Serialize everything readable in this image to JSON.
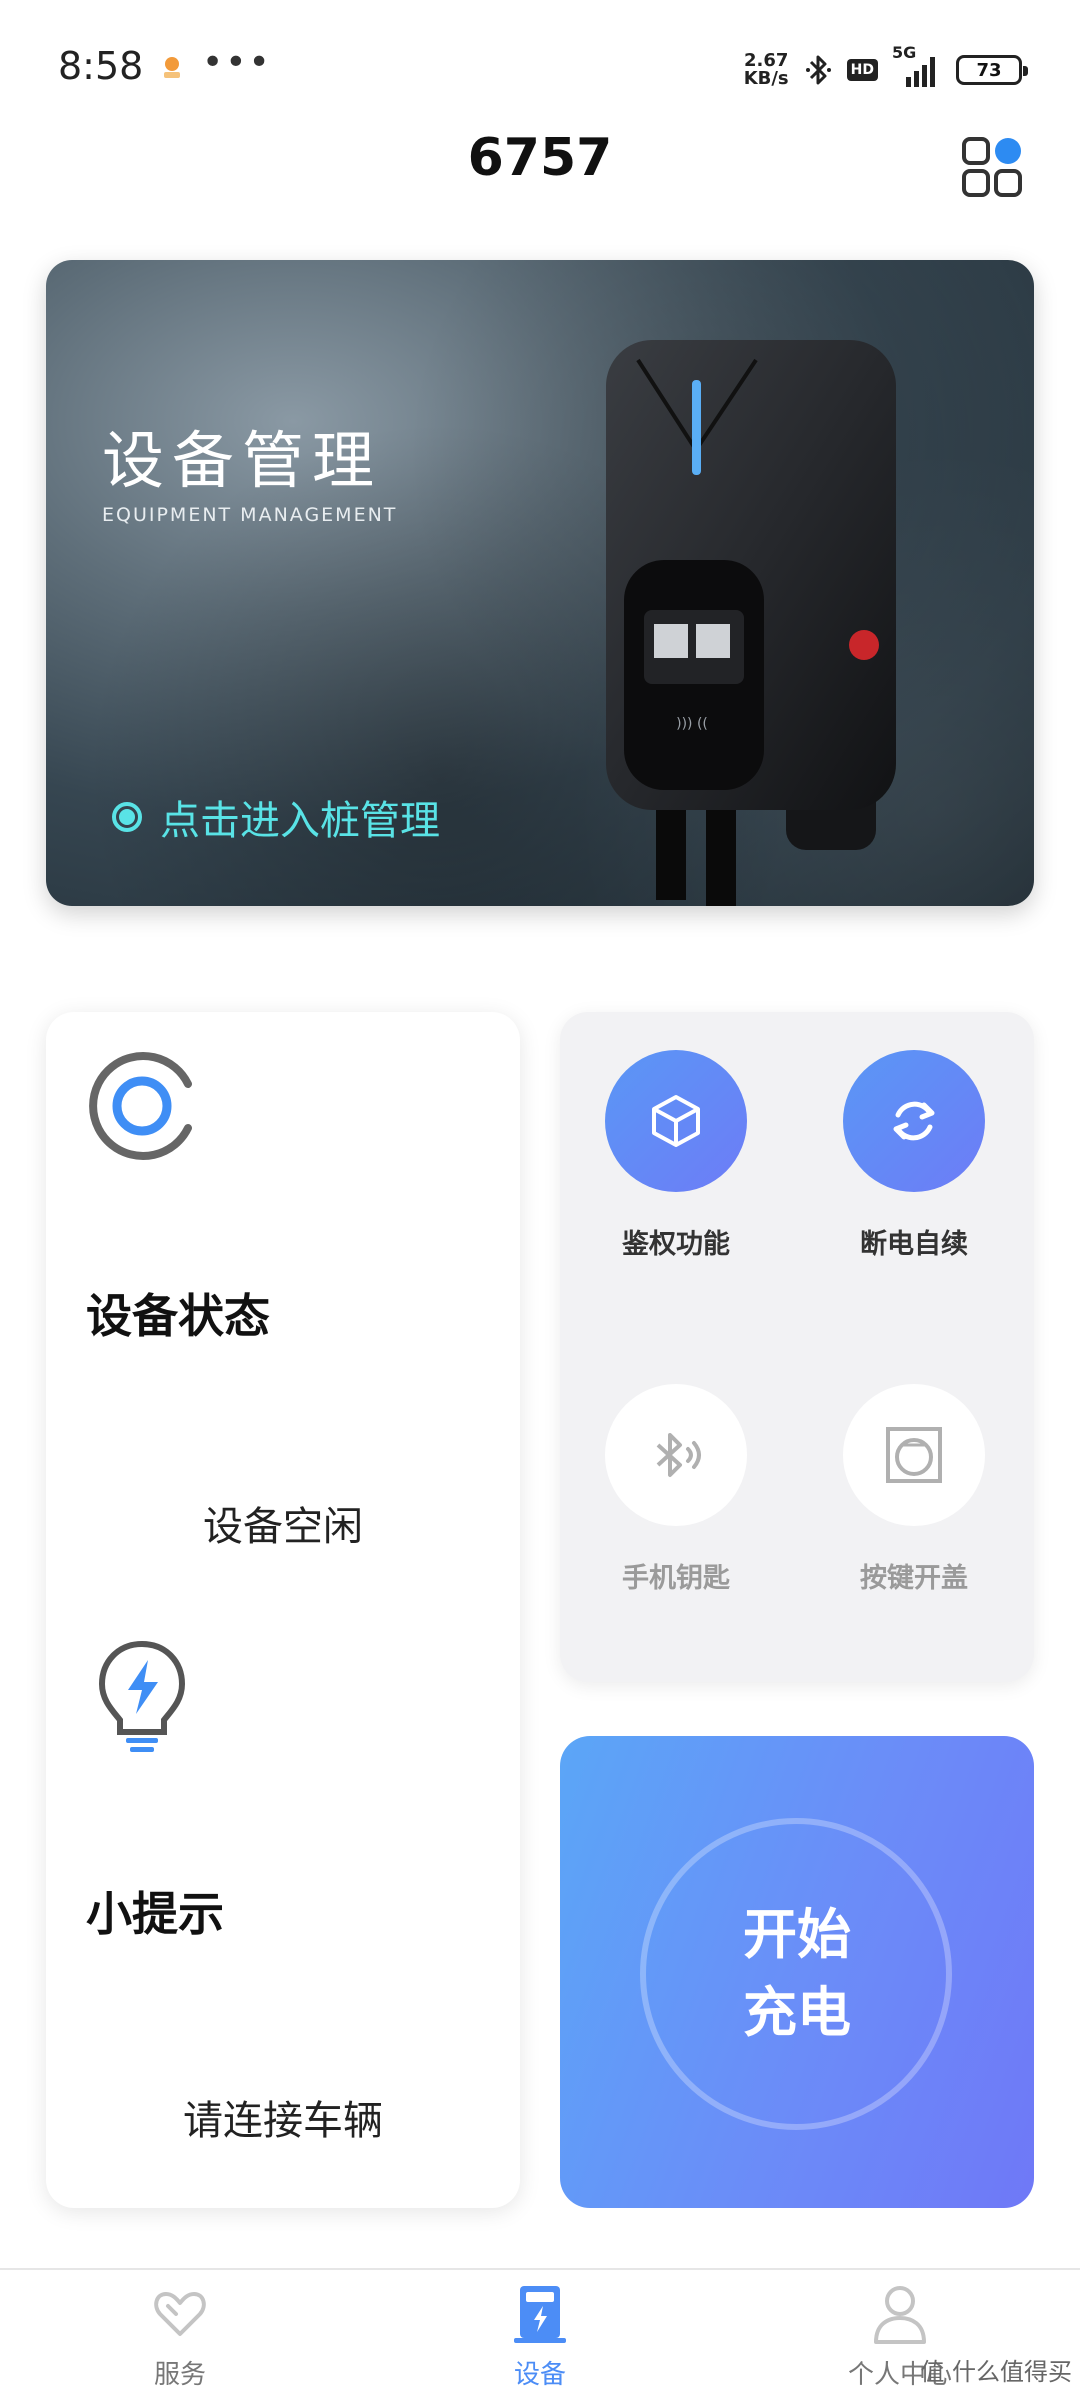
{
  "status_bar": {
    "time": "8:58",
    "more": "•••",
    "net_speed_value": "2.67",
    "net_speed_unit": "KB/s",
    "hd": "HD",
    "network": "5G",
    "battery": "73"
  },
  "header": {
    "title": "6757"
  },
  "banner": {
    "title": "设备管理",
    "subtitle": "EQUIPMENT MANAGEMENT",
    "link": "点击进入桩管理",
    "accent_color": "#59e3e6"
  },
  "status_card": {
    "status_heading": "设备状态",
    "status_value": "设备空闲",
    "tip_heading": "小提示",
    "tip_value": "请连接车辆"
  },
  "functions": [
    {
      "label": "鉴权功能",
      "icon": "cube-icon",
      "enabled": true
    },
    {
      "label": "断电自续",
      "icon": "refresh-icon",
      "enabled": true
    },
    {
      "label": "手机钥匙",
      "icon": "bluetooth-icon",
      "enabled": false
    },
    {
      "label": "按键开盖",
      "icon": "button-cover-icon",
      "enabled": false
    }
  ],
  "charge": {
    "line1": "开始",
    "line2": "充电"
  },
  "nav": [
    {
      "label": "服务",
      "icon": "heart-icon",
      "active": false
    },
    {
      "label": "设备",
      "icon": "charger-icon",
      "active": true
    },
    {
      "label": "个人中心",
      "icon": "person-icon",
      "active": false
    }
  ],
  "watermark": "值 什么值得买",
  "colors": {
    "primary": "#4c8df6",
    "gradient_start": "#5ba6f7",
    "gradient_end": "#6f78f7"
  }
}
